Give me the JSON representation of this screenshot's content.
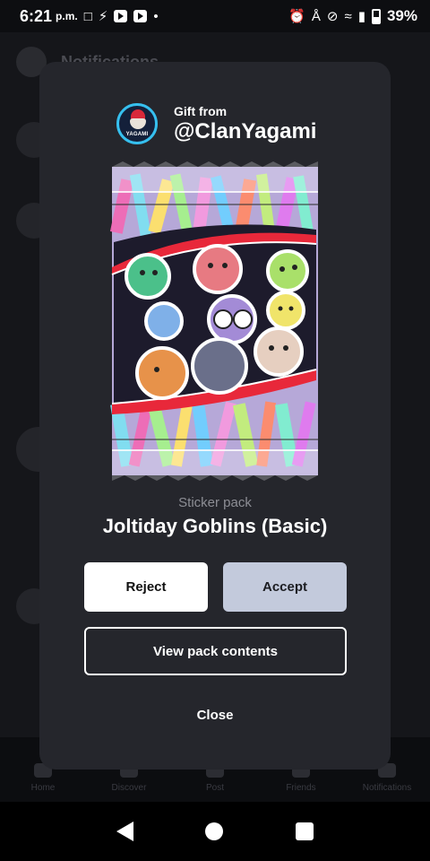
{
  "status_bar": {
    "time": "6:21",
    "ampm": "p.m.",
    "battery": "39%"
  },
  "background": {
    "title": "Notifications",
    "nav": [
      "Home",
      "Discover",
      "Post",
      "Friends",
      "Notifications"
    ]
  },
  "gift": {
    "from_label": "Gift from",
    "sender": "@ClanYagami",
    "avatar_tag": "YAGAMI"
  },
  "pack": {
    "type": "Sticker pack",
    "name": "Joltiday Goblins (Basic)"
  },
  "buttons": {
    "reject": "Reject",
    "accept": "Accept",
    "view_contents": "View pack contents",
    "close": "Close"
  },
  "colors": {
    "modal_bg": "#25262c",
    "accept_bg": "#c3cadc",
    "reject_bg": "#ffffff",
    "avatar_ring": "#36c0ef"
  },
  "icons": {
    "status_left": [
      "facebook-icon",
      "bolt-icon",
      "youtube-icon",
      "youtube-icon",
      "dot-icon"
    ],
    "status_right": [
      "alarm-icon",
      "bluetooth-icon",
      "mute-icon",
      "wifi-icon",
      "signal-icon",
      "battery-icon"
    ],
    "nav": [
      "back-icon",
      "home-icon",
      "recent-apps-icon"
    ]
  }
}
